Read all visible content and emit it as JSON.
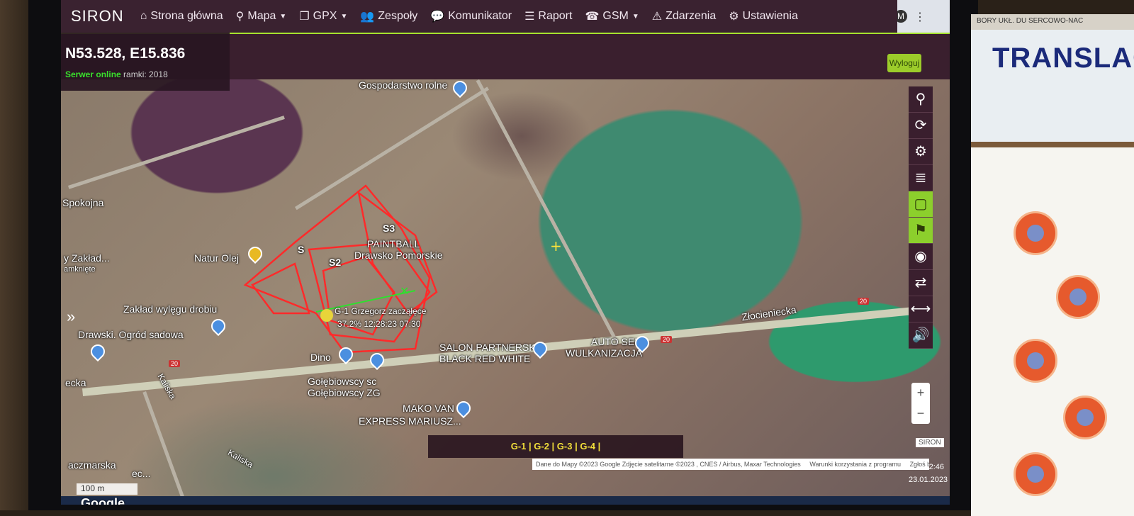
{
  "browser": {
    "icons": [
      "share-icon",
      "star-icon",
      "puzzle-icon",
      "sidebar-icon",
      "profile-icon",
      "menu-icon"
    ],
    "profile_letter": "M"
  },
  "app": {
    "brand": "SIRON"
  },
  "nav": [
    {
      "label": "Strona główna",
      "icon": "home-icon",
      "glyph": "⌂"
    },
    {
      "label": "Mapa",
      "icon": "map-pin-icon",
      "glyph": "⚲",
      "dropdown": true
    },
    {
      "label": "GPX",
      "icon": "copy-icon",
      "glyph": "❐",
      "dropdown": true
    },
    {
      "label": "Zespoły",
      "icon": "users-icon",
      "glyph": "👥"
    },
    {
      "label": "Komunikator",
      "icon": "chat-icon",
      "glyph": "💬"
    },
    {
      "label": "Raport",
      "icon": "list-icon",
      "glyph": "☰"
    },
    {
      "label": "GSM",
      "icon": "phone-icon",
      "glyph": "☎",
      "dropdown": true
    },
    {
      "label": "Zdarzenia",
      "icon": "warning-icon",
      "glyph": "⚠"
    },
    {
      "label": "Ustawienia",
      "icon": "gears-icon",
      "glyph": "⚙"
    }
  ],
  "status": {
    "coords": "N53.528, E15.836",
    "server": "Serwer online",
    "frames": "ramki: 2018"
  },
  "logout_label": "Wyloguj",
  "map": {
    "labels": [
      "Gospodarstwo rolne",
      "Spokojna",
      "Natur Olej",
      "y Zakład...",
      "amknięte",
      "Zakład wylęgu drobiu",
      "Drawski. Ogród sadowa",
      "Dino",
      "SALON PARTNERSKI",
      "BLACK RED WHITE",
      "AUTO SEK",
      "WULKANIZACJA",
      "Złocieniecka",
      "Gołębiowscy sc",
      "Gołębiowscy ZG",
      "MAKO VAN",
      "EXPRESS MARIUSZ...",
      "Kaliska",
      "Kaliska",
      "ecka",
      "aczmarska",
      "ec..."
    ],
    "sectors": [
      "S2",
      "S3",
      "S"
    ],
    "overlay_text": [
      "Drawsko Pomorskie",
      "PAINTBALL"
    ],
    "track_label": "G-1 Grzegorz zacząłęce",
    "track_stats": "37.2% 12:28:23 07:30",
    "road_badges": [
      "20",
      "20",
      "20"
    ]
  },
  "tools": [
    {
      "icon": "location-icon",
      "glyph": "⚲",
      "active": false
    },
    {
      "icon": "refresh-icon",
      "glyph": "⟳",
      "active": false
    },
    {
      "icon": "settings-icon",
      "glyph": "⚙",
      "active": false
    },
    {
      "icon": "layers-icon",
      "glyph": "≣",
      "active": false
    },
    {
      "icon": "square-icon",
      "glyph": "▢",
      "active": true
    },
    {
      "icon": "pin-icon",
      "glyph": "⚑",
      "active": true
    },
    {
      "icon": "eye-icon",
      "glyph": "◉",
      "active": false
    },
    {
      "icon": "sync-icon",
      "glyph": "⇄",
      "active": false
    },
    {
      "icon": "resize-icon",
      "glyph": "⟷",
      "active": false
    },
    {
      "icon": "volume-icon",
      "glyph": "🔊",
      "active": false
    }
  ],
  "zoom": {
    "in": "+",
    "out": "−"
  },
  "legend": "G-1 | G-2 | G-3 | G-4 |",
  "credits": {
    "data": "Dane do Mapy ©2023 Google Zdjęcie satelitarne ©2023 , CNES / Airbus, Maxar Technologies",
    "terms": "Warunki korzystania z programu",
    "report": "Zgłoś błąd w mapach"
  },
  "siron_tag": "SIRON",
  "clock": {
    "time": "12:46",
    "date": "23.01.2023"
  },
  "scale": "100 m",
  "google": "Google",
  "poster": {
    "strip": "BORY UKŁ. DU SERCOWO-NAC",
    "title": "TRANSLACJ"
  }
}
